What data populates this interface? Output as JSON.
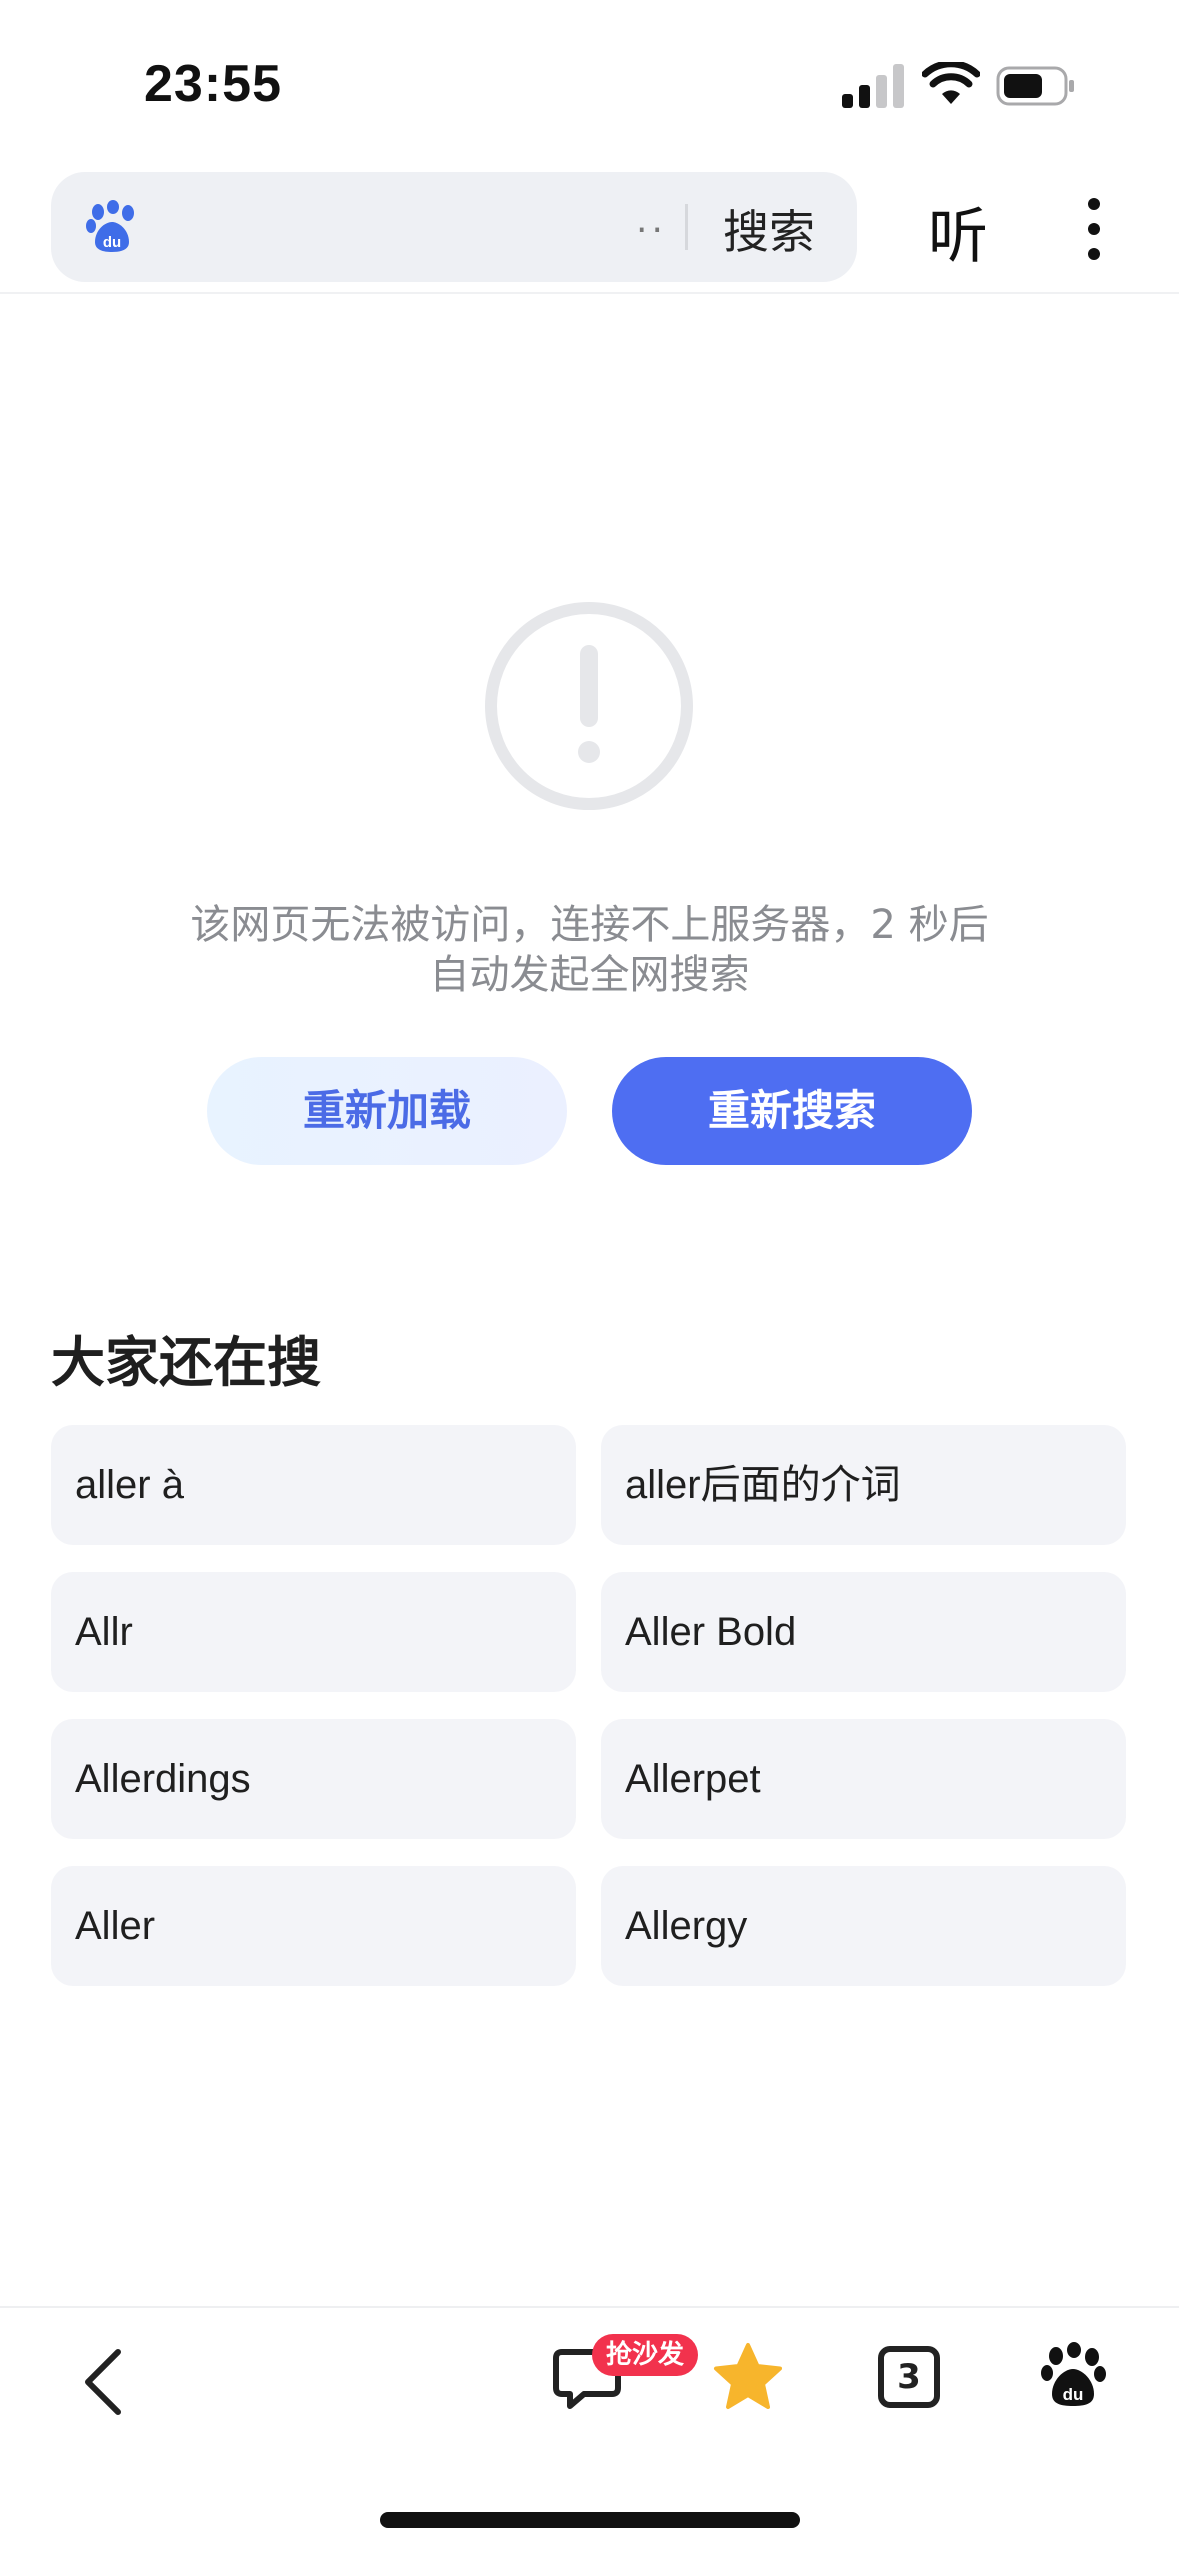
{
  "status_bar": {
    "time": "23:55"
  },
  "header": {
    "query_preview": "..",
    "search_label": "搜索",
    "listen_label": "听"
  },
  "error": {
    "message_line1": "该网页无法被访问，连接不上服务器，2 秒后",
    "message_line2": "自动发起全网搜索",
    "reload_label": "重新加载",
    "research_label": "重新搜索"
  },
  "related": {
    "title": "大家还在搜",
    "items": [
      "aller à",
      "aller后面的介词",
      "Allr",
      "Aller Bold",
      "Allerdings",
      "Allerpet",
      "Aller",
      "Allergy"
    ]
  },
  "toolbar": {
    "comment_badge": "抢沙发",
    "tab_count": "3"
  },
  "colors": {
    "accent": "#4e6ef2",
    "badge": "#f2324d",
    "star": "#f7b52c"
  }
}
